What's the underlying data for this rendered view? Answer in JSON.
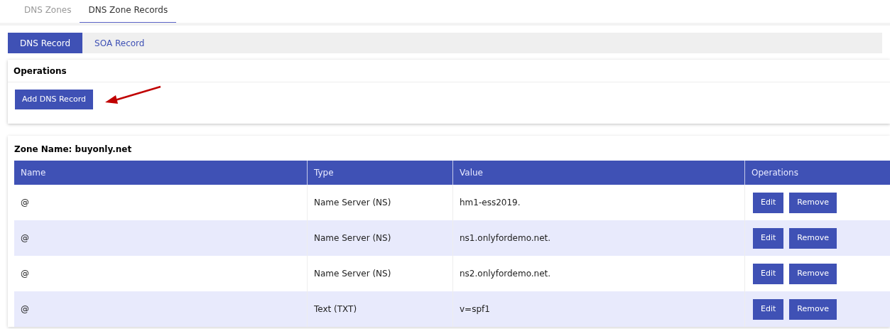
{
  "top_tabs": [
    {
      "label": "DNS Zones",
      "selected": false
    },
    {
      "label": "DNS Zone Records",
      "selected": true
    }
  ],
  "sub_tabs": [
    {
      "label": "DNS Record",
      "selected": true
    },
    {
      "label": "SOA Record",
      "selected": false
    }
  ],
  "operations_panel": {
    "title": "Operations",
    "button": "Add DNS Record"
  },
  "zone_panel": {
    "title": "Zone Name: buyonly.net",
    "table": {
      "columns": [
        "Name",
        "Type",
        "Value",
        "Operations"
      ],
      "rows": [
        {
          "name": "@",
          "type": "Name Server (NS)",
          "value": "hm1-ess2019.",
          "actions": [
            "Edit",
            "Remove"
          ]
        },
        {
          "name": "@",
          "type": "Name Server (NS)",
          "value": "ns1.onlyfordemo.net.",
          "actions": [
            "Edit",
            "Remove"
          ]
        },
        {
          "name": "@",
          "type": "Name Server (NS)",
          "value": "ns2.onlyfordemo.net.",
          "actions": [
            "Edit",
            "Remove"
          ]
        },
        {
          "name": "@",
          "type": "Text (TXT)",
          "value": "v=spf1",
          "actions": [
            "Edit",
            "Remove"
          ]
        }
      ]
    }
  }
}
